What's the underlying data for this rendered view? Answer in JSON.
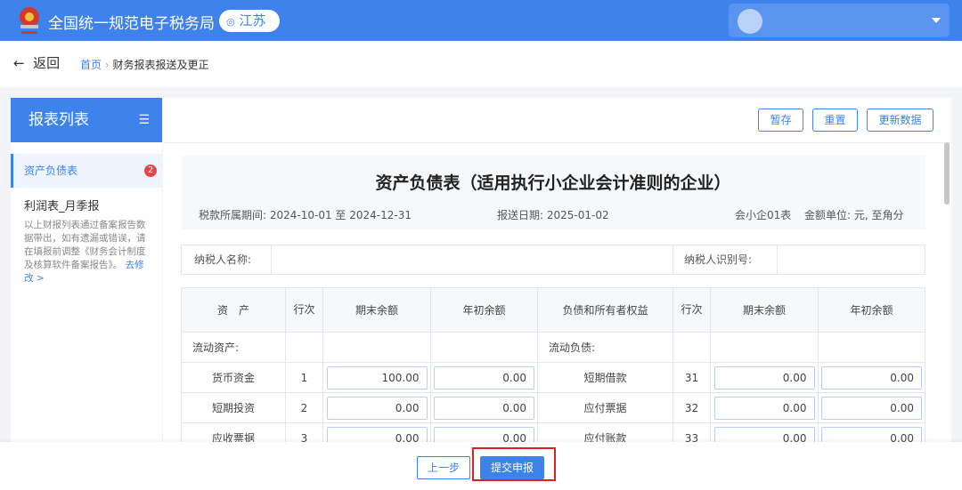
{
  "header": {
    "app_title": "全国统一规范电子税务局",
    "region": "江苏",
    "emblem_text": "国家税务总局"
  },
  "nav": {
    "back": "返回",
    "breadcrumb": [
      "首页",
      "财务报表报送及更正"
    ],
    "sep": "›"
  },
  "sidebar": {
    "title": "报表列表",
    "items": [
      {
        "label": "资产负债表",
        "badge": "2",
        "active": true
      },
      {
        "label": "利润表_月季报"
      }
    ],
    "note": "以上财报列表通过备案报告数据带出，如有遗漏或错误，请在填报前调整《财务会计制度及核算软件备案报告》。",
    "note_link": "去修改 >"
  },
  "toolbar": {
    "save": "暂存",
    "reset": "重置",
    "refresh": "更新数据"
  },
  "form": {
    "title": "资产负债表（适用执行小企业会计准则的企业）",
    "period": "税款所属期间:  2024-10-01  至  2024-12-31",
    "report_date": "报送日期:  2025-01-02",
    "form_code": "会小企01表",
    "unit": "金额单位: 元, 至角分",
    "taxpayer_name_label": "纳税人名称:",
    "taxpayer_id_label": "纳税人识别号:"
  },
  "table": {
    "headers": [
      "资　产",
      "行次",
      "期末余额",
      "年初余额",
      "负债和所有者权益",
      "行次",
      "期末余额",
      "年初余额"
    ],
    "rows": [
      {
        "a": "流动资产:",
        "l": "流动负债:",
        "section": true
      },
      {
        "a": "货币资金",
        "an": "1",
        "ae": "100.00",
        "ab": "0.00",
        "l": "短期借款",
        "ln": "31",
        "le": "0.00",
        "lb": "0.00"
      },
      {
        "a": "短期投资",
        "an": "2",
        "ae": "0.00",
        "ab": "0.00",
        "l": "应付票据",
        "ln": "32",
        "le": "0.00",
        "lb": "0.00"
      },
      {
        "a": "应收票据",
        "an": "3",
        "ae": "0.00",
        "ab": "0.00",
        "l": "应付账款",
        "ln": "33",
        "le": "0.00",
        "lb": "0.00"
      }
    ]
  },
  "footer": {
    "prev": "上一步",
    "submit": "提交申报"
  },
  "colors": {
    "primary": "#3e82ec",
    "highlight": "#e02020",
    "badge": "#e64545"
  }
}
